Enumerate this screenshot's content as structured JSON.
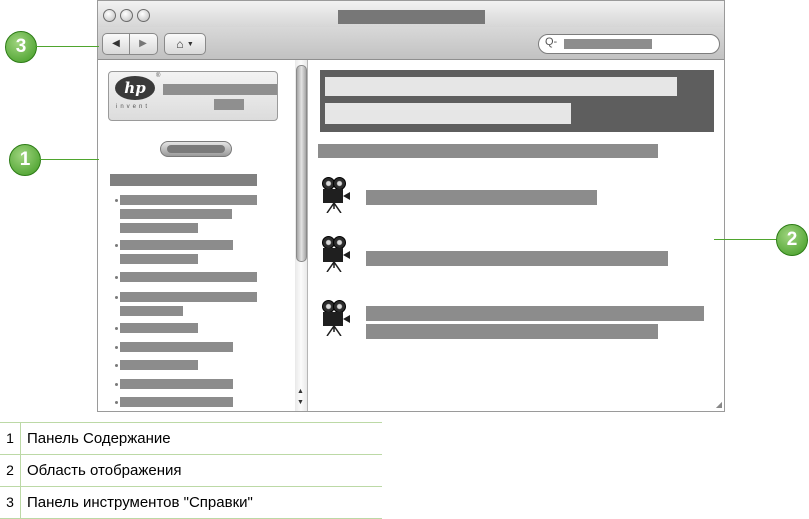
{
  "window": {
    "nav_back_label": "◀",
    "nav_forward_label": "▶",
    "home_label": "⌂",
    "search_icon_glyph": "Q-",
    "hp_logo_text": "hp",
    "hp_tagline": "invent"
  },
  "callouts": [
    "1",
    "2",
    "3"
  ],
  "legend": [
    {
      "num": "1",
      "text": "Панель Содержание"
    },
    {
      "num": "2",
      "text": "Область отображения"
    },
    {
      "num": "3",
      "text": "Панель инструментов \"Справки\""
    }
  ],
  "icons": {
    "video": "movie-camera-icon",
    "search": "magnifier-icon",
    "home": "home-icon"
  }
}
